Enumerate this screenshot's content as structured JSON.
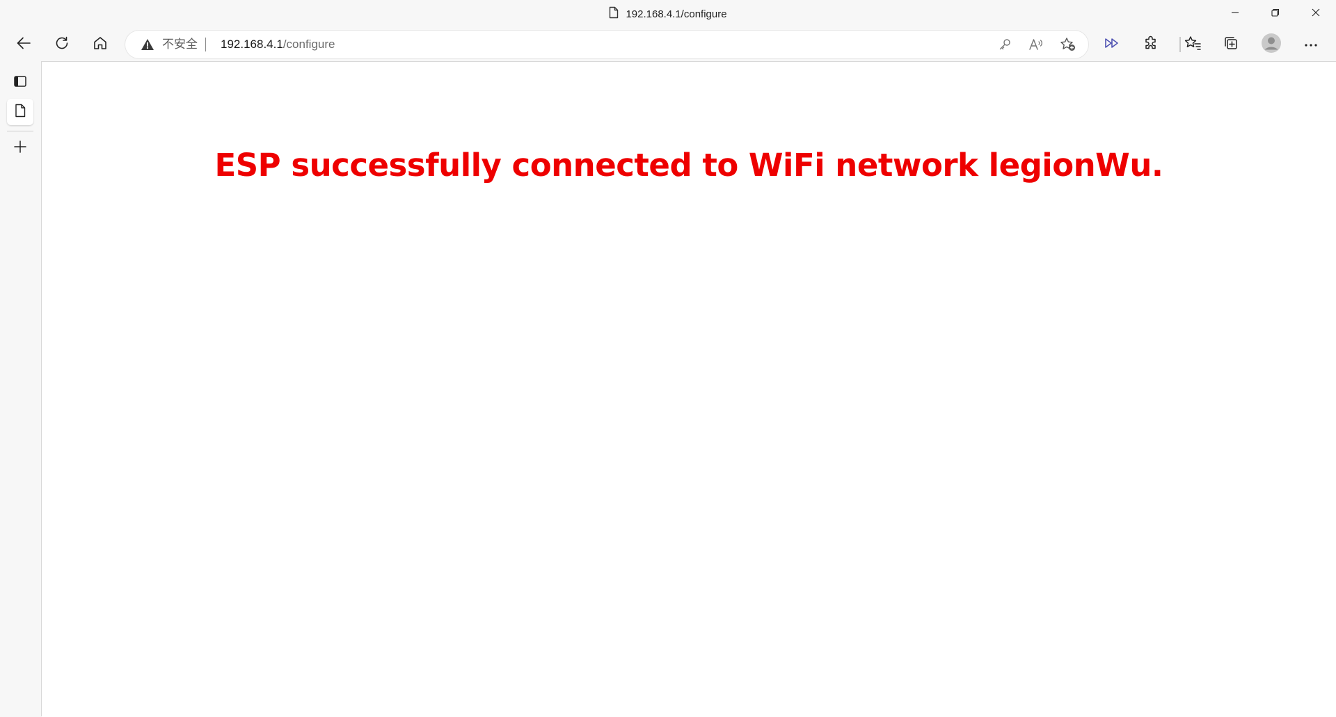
{
  "window": {
    "title": "192.168.4.1/configure"
  },
  "address_bar": {
    "security_label": "不安全",
    "url_host": "192.168.4.1",
    "url_path": "/configure"
  },
  "page": {
    "message": "ESP successfully connected to WiFi network legionWu."
  },
  "colors": {
    "message": "#ee0000",
    "page_background": "#ffffff",
    "chrome_background": "#f7f7f7",
    "immersive_reader_accent": "#4f52b2"
  },
  "icons": {
    "title_page": "document-icon",
    "back": "back-arrow-icon",
    "refresh": "refresh-icon",
    "home": "home-icon",
    "warning": "warning-icon",
    "password": "key-icon",
    "read_aloud": "read-aloud-icon",
    "add_favorite": "favorite-add-icon",
    "immersive_reader": "immersive-reader-icon",
    "extensions": "puzzle-icon",
    "favorites": "favorites-icon",
    "collections": "collections-icon",
    "profile": "avatar",
    "more": "more-icon"
  }
}
